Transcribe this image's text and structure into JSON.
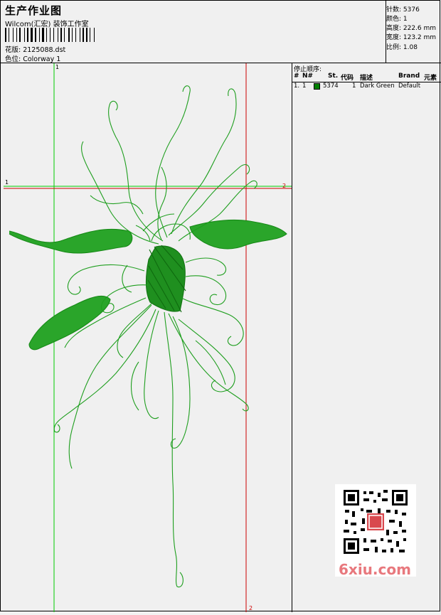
{
  "header": {
    "title": "生产作业图",
    "company": "Wilcom(汇宏) 装饰工作室",
    "design_label": "花版: 2125088.dst",
    "colorway_label": "色位: Colorway 1"
  },
  "stats": {
    "stitches": "针数: 5376",
    "colors": "颜色: 1",
    "height": "高度: 222.6 mm",
    "width": "宽度: 123.2 mm",
    "scale": "比例: 1.08"
  },
  "stop_sequence": {
    "title": "停止顺序:",
    "headers": {
      "num": "#",
      "n": "N#",
      "st": "St.",
      "code": "代码",
      "desc": "描述",
      "brand": "Brand",
      "elem": "元素"
    },
    "rows": [
      {
        "num": "1.",
        "n": "1",
        "st": "5374",
        "code": "1",
        "desc": "Dark Green",
        "brand": "Default"
      }
    ]
  },
  "guides": {
    "v1": "1",
    "h1_left": "1",
    "h2_right": "2",
    "v2_bottom": "2"
  },
  "colors": {
    "thread": "#008000",
    "guide_green": "#00cc00",
    "guide_red": "#cc0000"
  },
  "watermark": {
    "text": "6xiu.com"
  }
}
